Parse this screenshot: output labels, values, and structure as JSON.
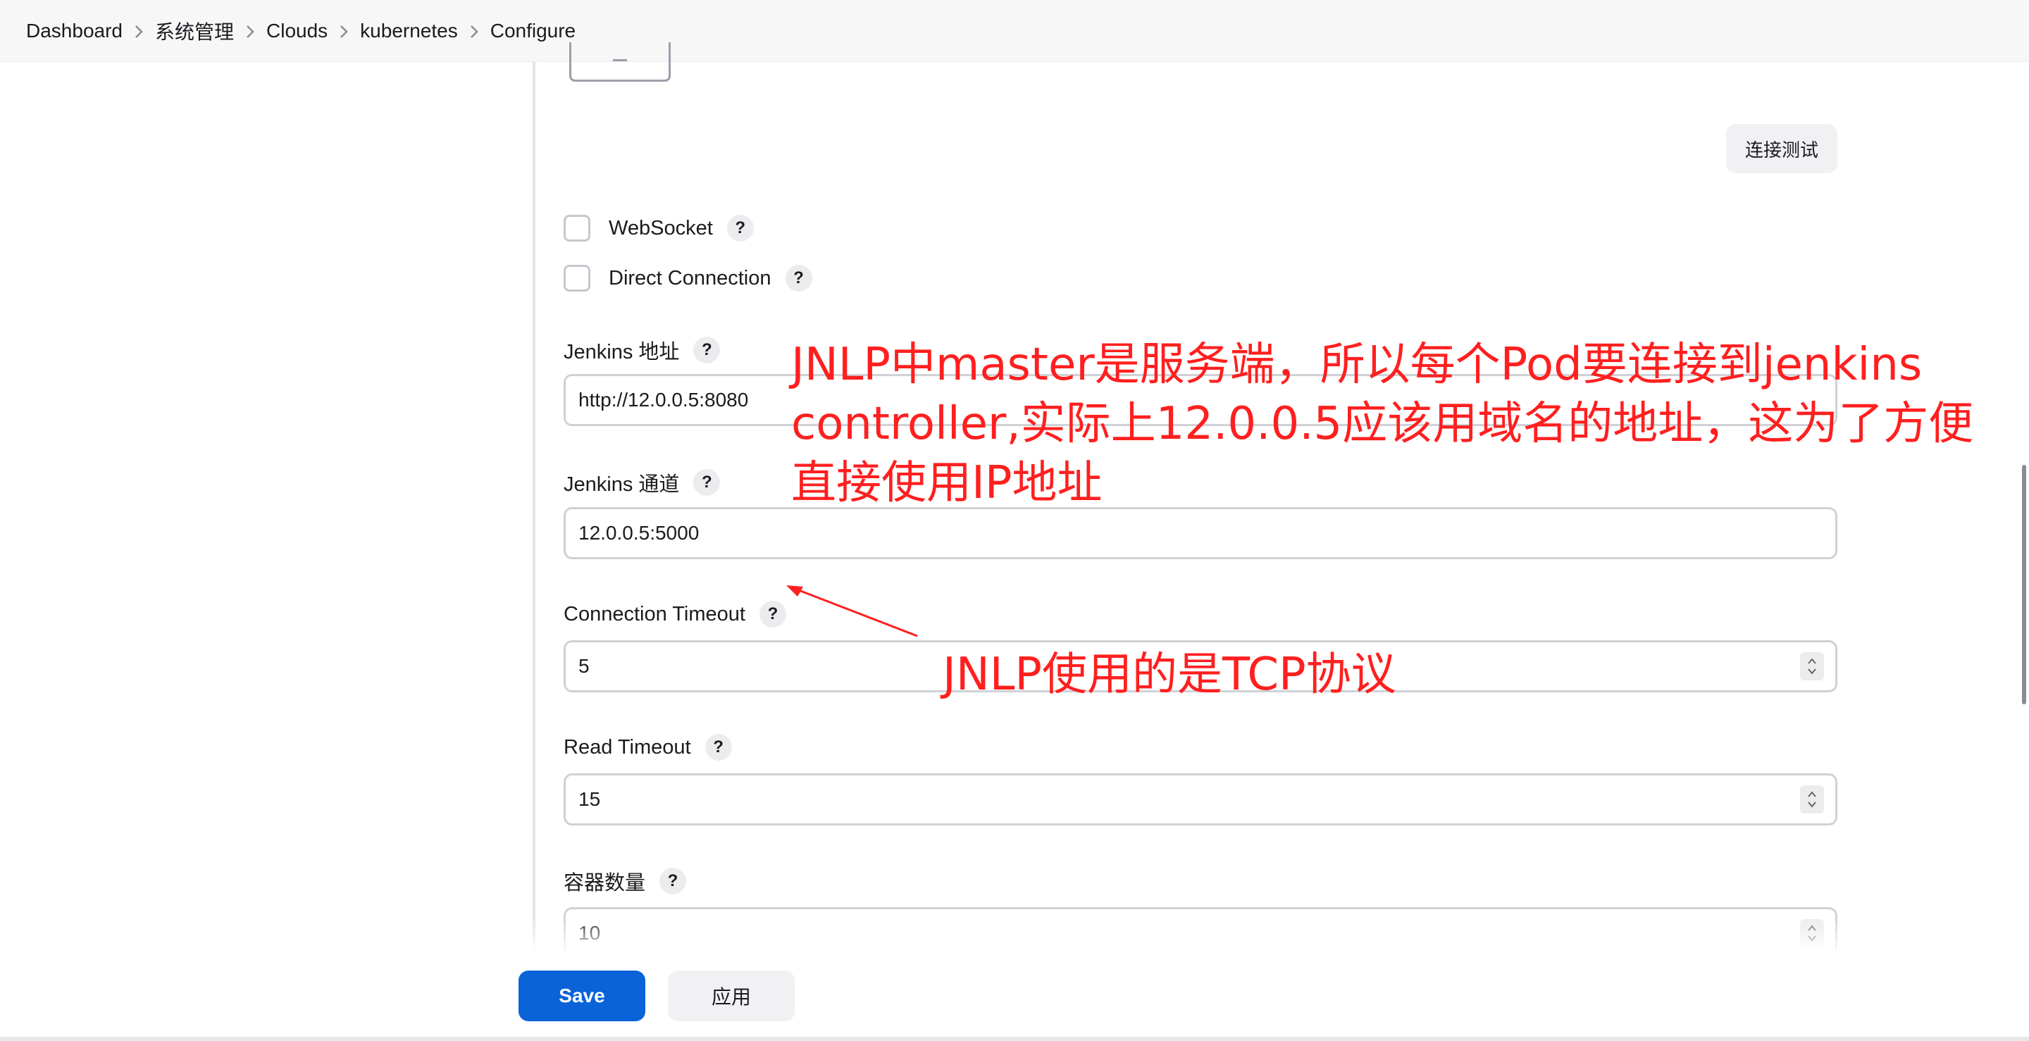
{
  "breadcrumb": [
    {
      "label": "Dashboard"
    },
    {
      "label": "系统管理"
    },
    {
      "label": "Clouds"
    },
    {
      "label": "kubernetes"
    },
    {
      "label": "Configure"
    }
  ],
  "test_connection_label": "连接测试",
  "checkboxes": {
    "websocket": {
      "label": "WebSocket",
      "checked": false
    },
    "direct_connection": {
      "label": "Direct Connection",
      "checked": false
    }
  },
  "help_glyph": "?",
  "fields": {
    "jenkins_url": {
      "label": "Jenkins 地址",
      "value": "http://12.0.0.5:8080"
    },
    "jenkins_tunnel": {
      "label": "Jenkins 通道",
      "value": "12.0.0.5:5000"
    },
    "connection_timeout": {
      "label": "Connection Timeout",
      "value": "5"
    },
    "read_timeout": {
      "label": "Read Timeout",
      "value": "15"
    },
    "container_cap": {
      "label": "容器数量",
      "value": "10"
    }
  },
  "annotations": {
    "main_note": "JNLP中master是服务端，所以每个Pod要连接到jenkins controller,实际上12.0.0.5应该用域名的地址，这为了方便直接使用IP地址",
    "tcp_note": "JNLP使用的是TCP协议"
  },
  "actions": {
    "save_label": "Save",
    "apply_label": "应用"
  },
  "colors": {
    "accent": "#0a63d8",
    "annotation": "#ff1f1f"
  }
}
